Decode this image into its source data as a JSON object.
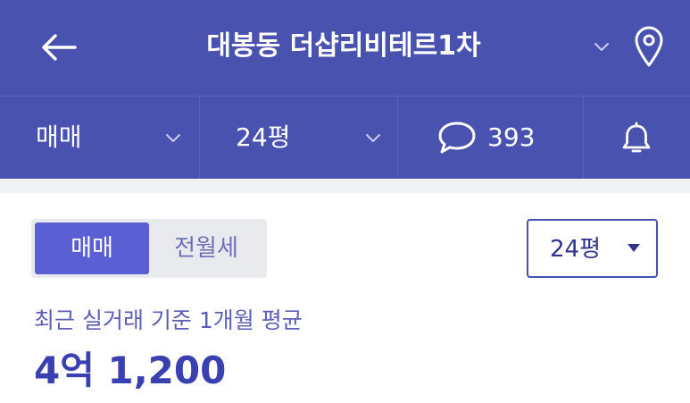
{
  "header": {
    "title": "대봉동 더샵리비테르1차",
    "icons": {
      "back": "arrow-left-icon",
      "expand": "chevron-down-icon",
      "location": "map-pin-icon"
    }
  },
  "filters": {
    "deal_type": "매매",
    "area": "24평",
    "comment_count": "393",
    "icons": {
      "comments": "speech-bubble-icon",
      "alert": "bell-icon"
    }
  },
  "segment": {
    "options": [
      {
        "label": "매매",
        "selected": true
      },
      {
        "label": "전월세",
        "selected": false
      }
    ]
  },
  "area_select": {
    "value": "24평"
  },
  "summary": {
    "caption": "최근 실거래 기준 1개월 평균",
    "price": "4억 1,200"
  },
  "colors": {
    "header_bg": "#4a52b0",
    "accent": "#5a60d4",
    "price_text": "#3b40b0",
    "caption_text": "#5b5fb6"
  }
}
